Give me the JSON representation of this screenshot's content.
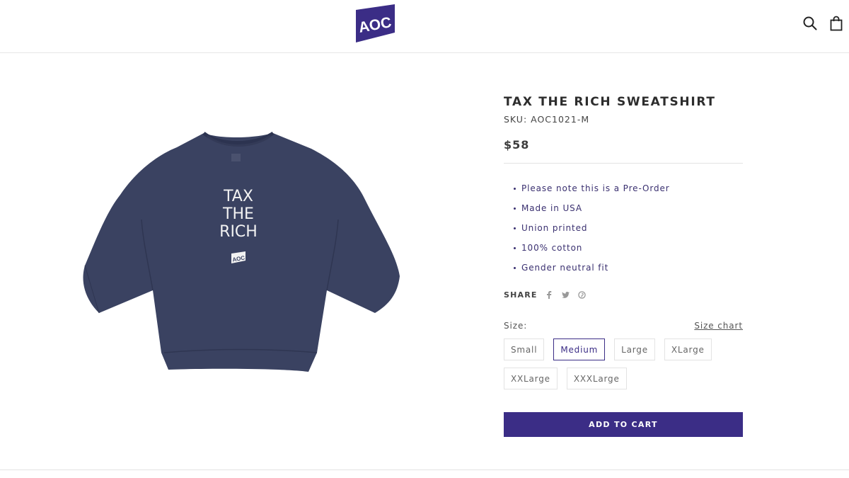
{
  "brand": {
    "logo_text": "AOC",
    "accent": "#3b2d86"
  },
  "header": {
    "search_icon": "search-icon",
    "cart_icon": "shopping-bag-icon"
  },
  "product": {
    "title": "TAX THE RICH SWEATSHIRT",
    "sku": "SKU: AOC1021-M",
    "price": "$58",
    "image_print_text": [
      "TAX",
      "THE",
      "RICH"
    ],
    "image_logo_text": "AOC",
    "features": [
      "Please note this is a Pre-Order",
      "Made in USA",
      "Union printed",
      "100% cotton",
      "Gender neutral fit"
    ]
  },
  "share": {
    "label": "SHARE",
    "icons": [
      "facebook-icon",
      "twitter-icon",
      "pinterest-icon"
    ]
  },
  "size": {
    "label": "Size:",
    "chart_link": "Size chart",
    "options": [
      "Small",
      "Medium",
      "Large",
      "XLarge",
      "XXLarge",
      "XXXLarge"
    ],
    "selected": "Medium"
  },
  "cart": {
    "add_label": "ADD TO CART"
  }
}
